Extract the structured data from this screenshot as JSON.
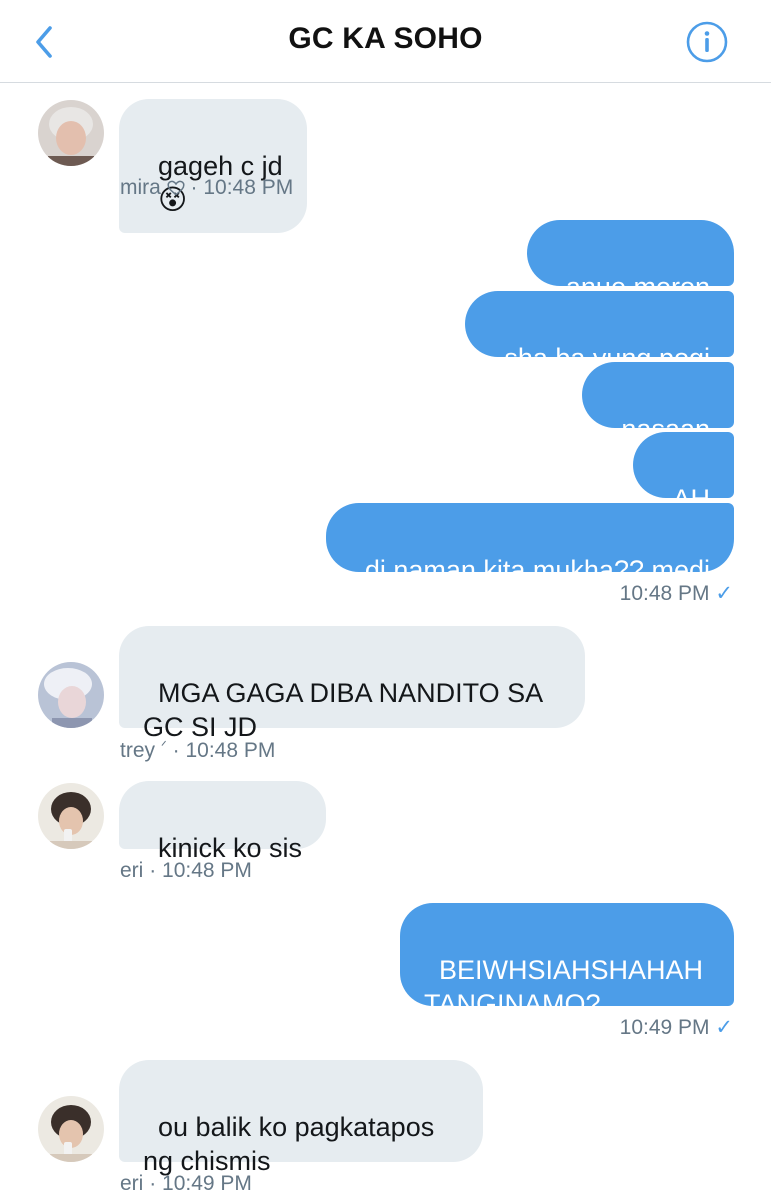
{
  "header": {
    "title": "GC KA SOHO"
  },
  "messages": {
    "m1": {
      "text": "gageh c jd",
      "emoji": "😵",
      "sender": "mira",
      "time": "· 10:48 PM"
    },
    "o1": {
      "text": "anue meron"
    },
    "o2": {
      "text": "sha ba yung pogi"
    },
    "o3": {
      "text": "nasaan"
    },
    "o4": {
      "text": "AH"
    },
    "o5": {
      "text": "di naman kita mukha?? medj"
    },
    "o5meta": {
      "time": "10:48 PM",
      "check": "✓"
    },
    "m2": {
      "text": "MGA GAGA DIBA NANDITO SA\nGC SI JD",
      "sender": "trey",
      "mark": "ᐟ",
      "time": "· 10:48 PM"
    },
    "m3": {
      "text": "kinick ko sis",
      "sender": "eri",
      "time": "· 10:48 PM"
    },
    "o6": {
      "text": "BEIWHSIAHSHAHAH\nTANGINAMO?"
    },
    "o6meta": {
      "time": "10:49 PM",
      "check": "✓"
    },
    "m4": {
      "text": "ou balik ko pagkatapos\nng chismis",
      "sender": "eri",
      "time": "· 10:49 PM"
    }
  },
  "colors": {
    "accent": "#4c9de8",
    "incoming": "#e6ecf0",
    "meta": "#657786"
  }
}
